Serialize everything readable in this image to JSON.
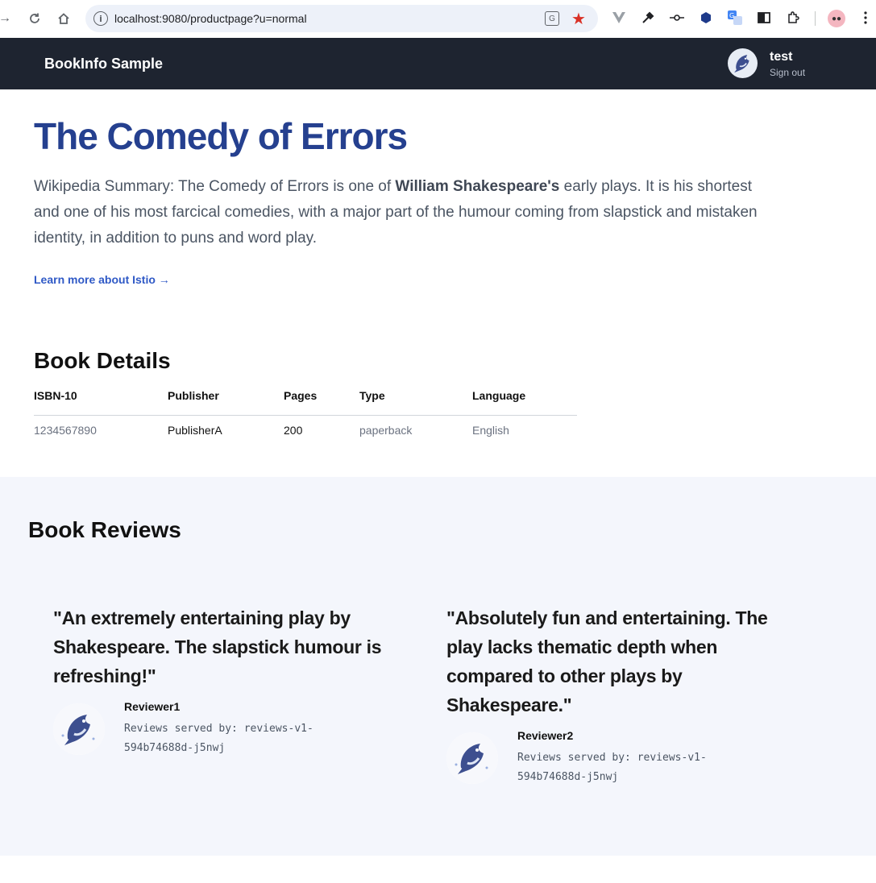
{
  "browser": {
    "url": "localhost:9080/productpage?u=normal"
  },
  "header": {
    "title": "BookInfo Sample",
    "user": "test",
    "signout": "Sign out"
  },
  "book": {
    "title": "The Comedy of Errors",
    "summary_prefix": "Wikipedia Summary: The Comedy of Errors is one of ",
    "summary_bold": "William Shakespeare's",
    "summary_suffix": " early plays. It is his shortest and one of his most farcical comedies, with a major part of the humour coming from slapstick and mistaken identity, in addition to puns and word play.",
    "learn_more": "Learn more about Istio →"
  },
  "details": {
    "heading": "Book Details",
    "columns": [
      "ISBN-10",
      "Publisher",
      "Pages",
      "Type",
      "Language"
    ],
    "values": [
      "1234567890",
      "PublisherA",
      "200",
      "paperback",
      "English"
    ]
  },
  "reviews": {
    "heading": "Book Reviews",
    "items": [
      {
        "quote": "\"An extremely entertaining play by Shakespeare. The slapstick humour is refreshing!\"",
        "reviewer": "Reviewer1",
        "served_by": "Reviews served by: reviews-v1-594b74688d-j5nwj"
      },
      {
        "quote": "\"Absolutely fun and entertaining. The play lacks thematic depth when compared to other plays by Shakespeare.\"",
        "reviewer": "Reviewer2",
        "served_by": "Reviews served by: reviews-v1-594b74688d-j5nwj"
      }
    ]
  },
  "icons": {
    "back": "back-arrow-icon",
    "reload": "reload-icon",
    "home": "home-icon",
    "info": "site-info-icon",
    "translate": "translate-icon",
    "bookmark": "bookmark-star-icon",
    "avatar": "dolphin-avatar"
  },
  "colors": {
    "header_bg": "#1e2430",
    "title": "#25408f",
    "link": "#2f59c6",
    "reviews_bg": "#f4f6fc",
    "star": "#d93025"
  }
}
